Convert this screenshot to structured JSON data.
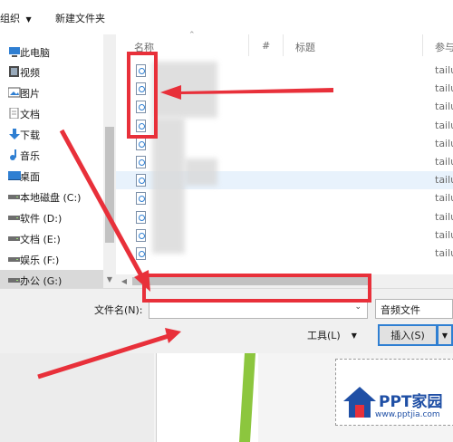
{
  "toolbar": {
    "organize_label": "组织",
    "organize_arrow": "▼",
    "new_folder_label": "新建文件夹"
  },
  "nav": {
    "items": [
      {
        "label": "此电脑",
        "icon": "computer-icon"
      },
      {
        "label": "视频",
        "icon": "video-icon"
      },
      {
        "label": "图片",
        "icon": "picture-icon"
      },
      {
        "label": "文档",
        "icon": "document-icon"
      },
      {
        "label": "下载",
        "icon": "download-arrow-icon"
      },
      {
        "label": "音乐",
        "icon": "music-note-icon"
      },
      {
        "label": "桌面",
        "icon": "desktop-icon"
      },
      {
        "label": "本地磁盘 (C:)",
        "icon": "drive-icon"
      },
      {
        "label": "软件 (D:)",
        "icon": "drive-icon"
      },
      {
        "label": "文档 (E:)",
        "icon": "drive-icon"
      },
      {
        "label": "娱乐 (F:)",
        "icon": "drive-icon"
      },
      {
        "label": "办公 (G:)",
        "icon": "drive-icon",
        "selected": true
      }
    ]
  },
  "list": {
    "columns": [
      "名称",
      "#",
      "标题",
      "参与"
    ],
    "artist_cell": "tailu"
  },
  "footer": {
    "filename_label": "文件名(N):",
    "filename_value": "",
    "filetype_value": "音频文件",
    "tools_label": "工具(L)",
    "insert_label": "插入(S)"
  },
  "watermark": {
    "brand": "PPT家园",
    "url": "www.pptjia.com"
  },
  "colors": {
    "annotation_red": "#e8303a",
    "selection_blue": "#e8f2fc",
    "accent_blue": "#2f7fd2"
  }
}
